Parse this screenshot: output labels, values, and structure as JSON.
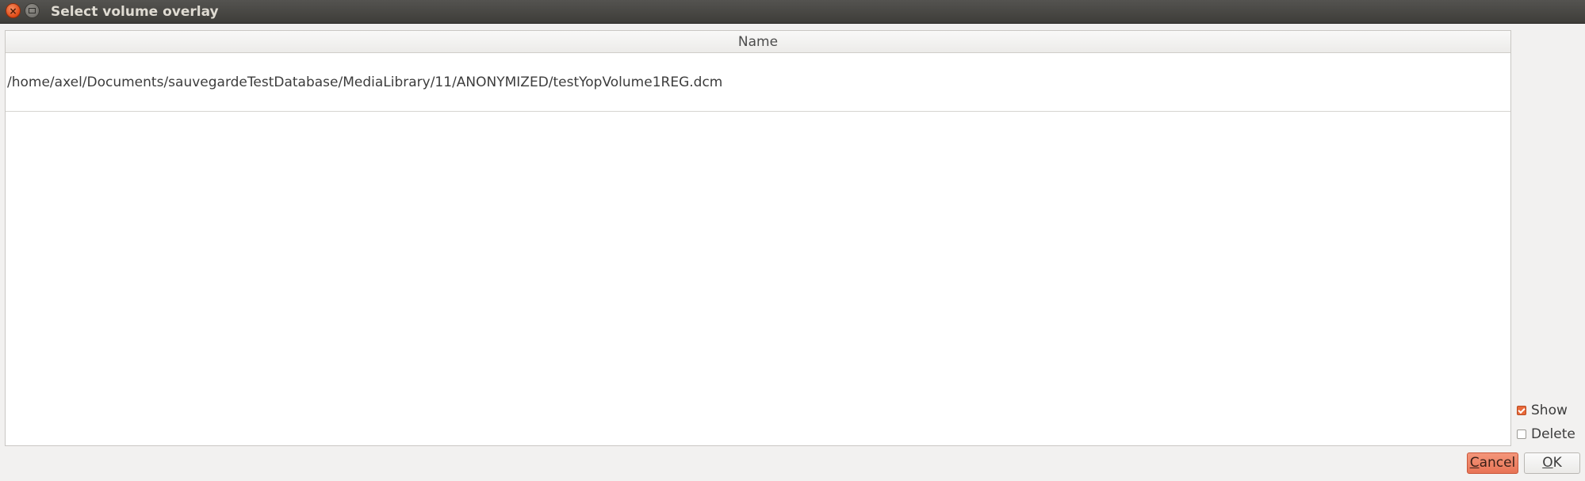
{
  "window": {
    "title": "Select volume overlay"
  },
  "list": {
    "column_header": "Name",
    "rows": [
      "/home/axel/Documents/sauvegardeTestDatabase/MediaLibrary/11/ANONYMIZED/testYopVolume1REG.dcm"
    ]
  },
  "options": {
    "show_label": "Show",
    "show_checked": true,
    "delete_label": "Delete",
    "delete_checked": false
  },
  "buttons": {
    "cancel_mnemonic": "C",
    "cancel_rest": "ancel",
    "ok_mnemonic": "O",
    "ok_rest": "K"
  },
  "colors": {
    "accent": "#e8693a",
    "titlebar": "#3e3d39"
  }
}
